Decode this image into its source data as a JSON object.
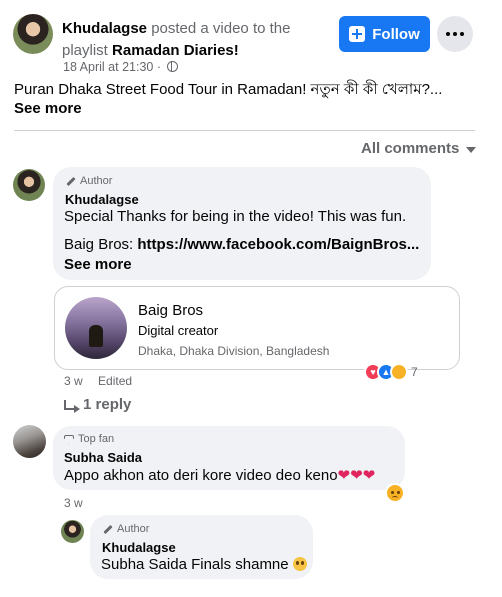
{
  "post": {
    "author": "Khudalagse",
    "action": "posted a video to the playlist",
    "playlist": "Ramadan Diaries!",
    "timestamp": "18 April at 21:30",
    "text": "Puran Dhaka Street Food Tour in Ramadan! নতুন কী কী খেলাম?...",
    "see_more": "See more",
    "follow_label": "Follow"
  },
  "comments_filter": {
    "label": "All comments"
  },
  "comments": [
    {
      "badge": "Author",
      "name": "Khudalagse",
      "line1": "Special Thanks for being in the video! This was fun.",
      "line2_prefix": "Baig Bros:",
      "line2_link": "https://www.facebook.com/BaignBros...",
      "see_more": "See more",
      "card": {
        "name": "Baig Bros",
        "role": "Digital creator",
        "location": "Dhaka, Dhaka Division, Bangladesh"
      },
      "time": "3 w",
      "edited": "Edited",
      "reaction_count": "7",
      "replies_label": "1 reply"
    },
    {
      "badge": "Top fan",
      "name": "Subha Saida",
      "text": "Appo akhon ato deri kore video deo keno",
      "hearts": "❤❤❤",
      "time": "3 w"
    },
    {
      "badge": "Author",
      "name": "Khudalagse",
      "text": "Subha Saida Finals shamne"
    }
  ],
  "colors": {
    "accent": "#1877f2",
    "secondary_text": "#65676b",
    "bubble": "#f0f2f5"
  }
}
